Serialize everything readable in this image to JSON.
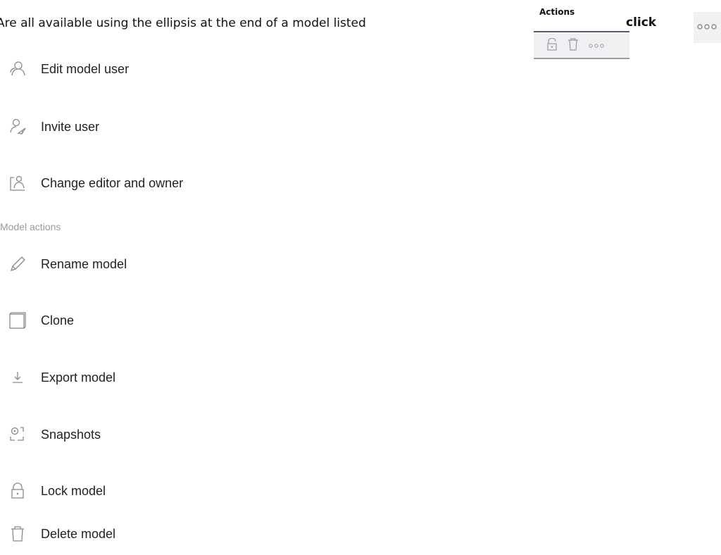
{
  "intro": {
    "text": "Are all available using the ellipsis at the end of a model listed",
    "click_label": "click"
  },
  "actions_panel": {
    "title": "Actions",
    "icons": [
      "lock-icon",
      "trash-icon",
      "ellipsis-icon"
    ]
  },
  "ellipsis_button": {
    "icon": "ellipsis-icon"
  },
  "user_actions": [
    {
      "label": "Edit model user",
      "icon": "users-icon"
    },
    {
      "label": "Invite user",
      "icon": "invite-user-icon"
    },
    {
      "label": "Change editor and owner",
      "icon": "change-owner-icon"
    }
  ],
  "section_header": "Model actions",
  "model_actions": [
    {
      "label": "Rename model",
      "icon": "pencil-icon"
    },
    {
      "label": "Clone",
      "icon": "clone-icon"
    },
    {
      "label": "Export model",
      "icon": "download-icon"
    },
    {
      "label": "Snapshots",
      "icon": "snapshot-icon"
    },
    {
      "label": "Lock model",
      "icon": "lock-icon"
    },
    {
      "label": "Delete model",
      "icon": "trash-icon"
    }
  ],
  "colors": {
    "icon_stroke": "#8a8a8a",
    "header_gray": "#9a9a9a",
    "panel_bg": "#f0f0f2"
  }
}
